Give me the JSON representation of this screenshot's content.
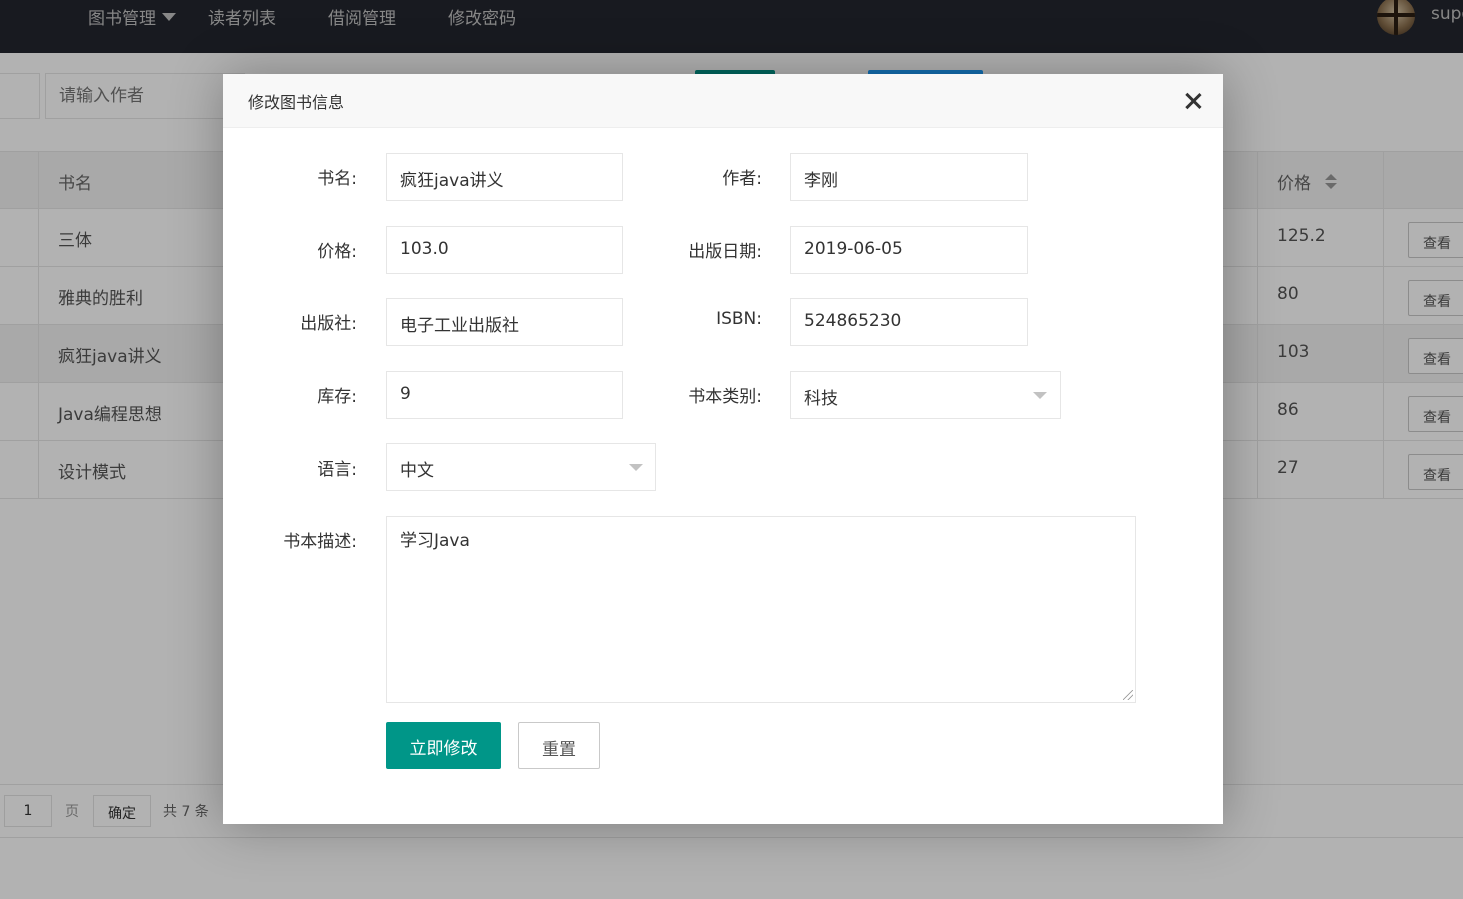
{
  "nav": {
    "items": [
      {
        "label": "图书管理",
        "has_caret": true
      },
      {
        "label": "读者列表"
      },
      {
        "label": "借阅管理"
      },
      {
        "label": "修改密码"
      }
    ],
    "username": "supe"
  },
  "search": {
    "author_placeholder": "请输入作者"
  },
  "table": {
    "columns": [
      "书名",
      "价格"
    ],
    "rows": [
      {
        "name": "三体",
        "price": "125.2",
        "action": "查看"
      },
      {
        "name": "雅典的胜利",
        "price": "80",
        "action": "查看"
      },
      {
        "name": "疯狂java讲义",
        "price": "103",
        "action": "查看"
      },
      {
        "name": "Java编程思想",
        "price": "86",
        "action": "查看"
      },
      {
        "name": "设计模式",
        "price": "27",
        "action": "查看"
      }
    ]
  },
  "pager": {
    "current_page": "1",
    "page_unit": "页",
    "go_label": "确定",
    "total_text": "共 7 条"
  },
  "dialog": {
    "title": "修改图书信息",
    "fields": {
      "name": {
        "label": "书名:",
        "value": "疯狂java讲义"
      },
      "author": {
        "label": "作者:",
        "value": "李刚"
      },
      "price": {
        "label": "价格:",
        "value": "103.0"
      },
      "pub_date": {
        "label": "出版日期:",
        "value": "2019-06-05"
      },
      "publisher": {
        "label": "出版社:",
        "value": "电子工业出版社"
      },
      "isbn": {
        "label": "ISBN:",
        "value": "524865230"
      },
      "stock": {
        "label": "库存:",
        "value": "9"
      },
      "category": {
        "label": "书本类别:",
        "value": "科技"
      },
      "language": {
        "label": "语言:",
        "value": "中文"
      },
      "description": {
        "label": "书本描述:",
        "value": "学习Java"
      }
    },
    "submit_label": "立即修改",
    "reset_label": "重置"
  },
  "colors": {
    "topbar": "#23262e",
    "primary": "#009688",
    "accent_blue": "#1e9fff"
  },
  "icons": [
    "caret-down-icon",
    "sort-icon",
    "close-icon",
    "select-arrow-icon",
    "resize-grip-icon"
  ]
}
